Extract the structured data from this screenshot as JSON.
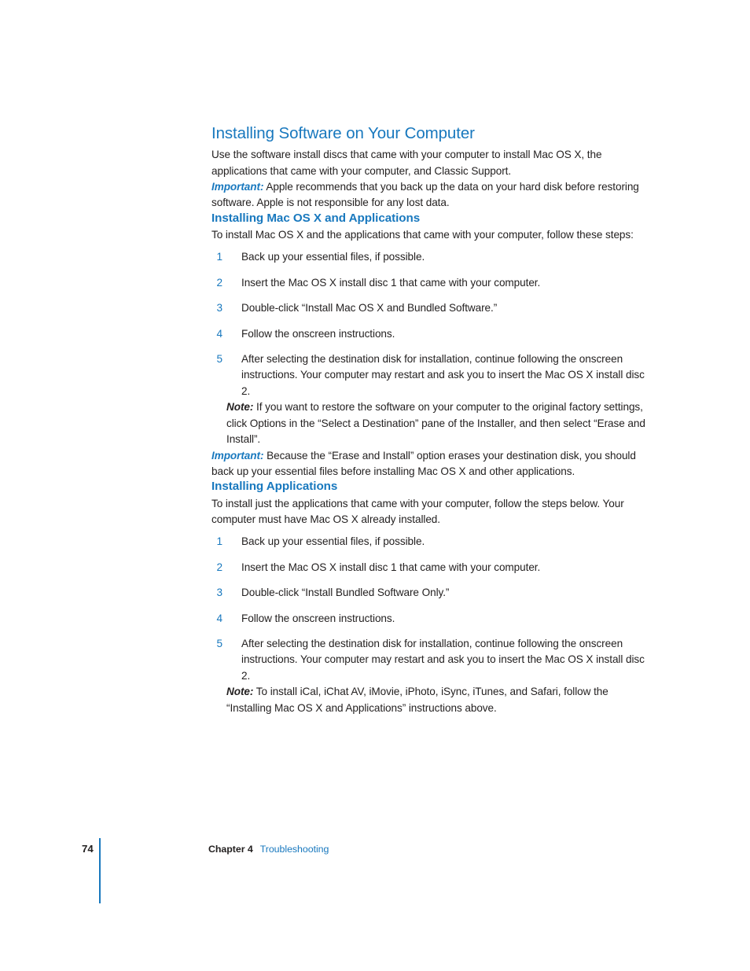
{
  "document": {
    "section": {
      "title": "Installing Software on Your Computer",
      "intro": "Use the software install discs that came with your computer to install Mac OS X, the applications that came with your computer, and Classic Support.",
      "important_label": "Important:",
      "important_text": " Apple recommends that you back up the data on your hard disk before restoring software. Apple is not responsible for any lost data."
    },
    "subsection_1": {
      "title": "Installing Mac OS X and Applications",
      "intro": "To install Mac OS X and the applications that came with your computer, follow these steps:",
      "steps": [
        {
          "num": "1",
          "text": "Back up your essential files, if possible."
        },
        {
          "num": "2",
          "text": "Insert the Mac OS X install disc 1 that came with your computer."
        },
        {
          "num": "3",
          "text": "Double-click “Install Mac OS X and Bundled Software.”"
        },
        {
          "num": "4",
          "text": "Follow the onscreen instructions."
        },
        {
          "num": "5",
          "text": "After selecting the destination disk for installation, continue following the onscreen instructions. Your computer may restart and ask you to insert the Mac OS X install disc 2."
        }
      ],
      "note_label": "Note:",
      "note_text": " If you want to restore the software on your computer to the original factory settings, click Options in the “Select a Destination” pane of the Installer, and then select “Erase and Install”.",
      "important_label": "Important:",
      "important_text": " Because the “Erase and Install” option erases your destination disk, you should back up your essential files before installing Mac OS X and other applications."
    },
    "subsection_2": {
      "title": "Installing Applications",
      "intro": "To install just the applications that came with your computer, follow the steps below. Your computer must have Mac OS X already installed.",
      "steps": [
        {
          "num": "1",
          "text": "Back up your essential files, if possible."
        },
        {
          "num": "2",
          "text": "Insert the Mac OS X install disc 1 that came with your computer."
        },
        {
          "num": "3",
          "text": "Double-click “Install Bundled Software Only.”"
        },
        {
          "num": "4",
          "text": "Follow the onscreen instructions."
        },
        {
          "num": "5",
          "text": "After selecting the destination disk for installation, continue following the onscreen instructions. Your computer may restart and ask you to insert the Mac OS X install disc 2."
        }
      ],
      "note_label": "Note:",
      "note_text": " To install iCal, iChat AV, iMovie, iPhoto, iSync, iTunes, and Safari, follow the “Installing Mac OS X and Applications” instructions above."
    },
    "footer": {
      "page_number": "74",
      "chapter": "Chapter 4",
      "topic": "Troubleshooting"
    },
    "colors": {
      "accent_blue": "#1878be",
      "body_black": "#221f1f",
      "page_background": "#ffffff"
    }
  }
}
